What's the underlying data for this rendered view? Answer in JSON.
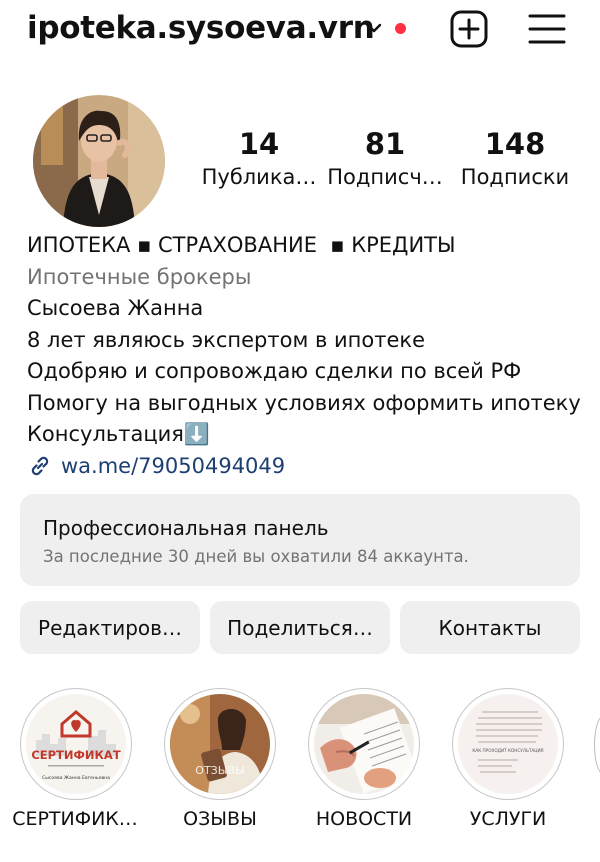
{
  "header": {
    "username": "ipoteka.sysoeva.vrn",
    "notification_dot_color": "#ff3040",
    "icons": [
      "chevron-down-icon",
      "plus-square-icon",
      "hamburger-menu-icon"
    ]
  },
  "profile": {
    "stats": [
      {
        "value": "14",
        "label": "Публика…"
      },
      {
        "value": "81",
        "label": "Подписч…"
      },
      {
        "value": "148",
        "label": "Подписки"
      }
    ]
  },
  "bio": {
    "headline": "ИПОТЕКА ▪ СТРАХОВАНИЕ  ▪ КРЕДИТЫ",
    "category": "Ипотечные брокеры",
    "name": "Сысоева Жанна",
    "lines": [
      "8 лет являюсь экспертом в ипотеке",
      "Одобряю и сопровождаю сделки по всей РФ",
      "Помогу на выгодных условиях оформить ипотеку",
      "Консультация⬇️"
    ],
    "link": "wa.me/79050494049",
    "link_color": "#1d3f72"
  },
  "dashboard": {
    "title": "Профессиональная панель",
    "subtitle": "За последние 30 дней вы охватили 84 аккаунта."
  },
  "actions": {
    "edit": "Редактиров…",
    "share": "Поделиться…",
    "contacts": "Контакты"
  },
  "highlights": [
    {
      "label": "СЕРТИФИК…",
      "thumb_title": "СЕРТИФИКАТ",
      "thumb_sub": "Сысоева Жанна Евгеньевна",
      "accent": "#c0392b"
    },
    {
      "label": "ОЗЫВЫ",
      "thumb_title": "ОТЗЫВЫ"
    },
    {
      "label": "НОВОСТИ"
    },
    {
      "label": "УСЛУГИ",
      "thumb_title": "КАК ПРОХОДИТ КОНСУЛЬТАЦИЯ"
    }
  ]
}
